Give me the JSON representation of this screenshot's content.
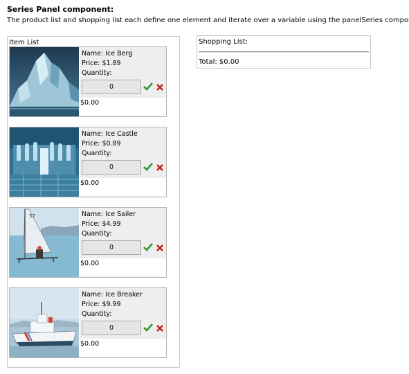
{
  "header": {
    "title": "Series Panel component:",
    "description": "The product list and shopping list each define one element and iterate over a variable using the panelSeries component."
  },
  "item_list": {
    "label": "Item List",
    "items": [
      {
        "name": "Name: Ice Berg",
        "price": "Price: $1.89",
        "quantity_label": "Quantity:",
        "quantity_value": "0",
        "subtotal": "$0.00",
        "image": "iceberg"
      },
      {
        "name": "Name: Ice Castle",
        "price": "Price: $0.89",
        "quantity_label": "Quantity:",
        "quantity_value": "0",
        "subtotal": "$0.00",
        "image": "ice-castle"
      },
      {
        "name": "Name: Ice Sailer",
        "price": "Price: $4.99",
        "quantity_label": "Quantity:",
        "quantity_value": "0",
        "subtotal": "$0.00",
        "image": "ice-sailer"
      },
      {
        "name": "Name: Ice Breaker",
        "price": "Price: $9.99",
        "quantity_label": "Quantity:",
        "quantity_value": "0",
        "subtotal": "$0.00",
        "image": "ice-breaker"
      }
    ]
  },
  "shopping_list": {
    "title": "Shopping List:",
    "total": "Total: $0.00"
  },
  "icons": {
    "accept": "checkmark-icon",
    "remove": "x-icon"
  },
  "colors": {
    "accept": "#2e9a2e",
    "remove": "#c41a1a",
    "detail_bg": "#eeeeee"
  }
}
